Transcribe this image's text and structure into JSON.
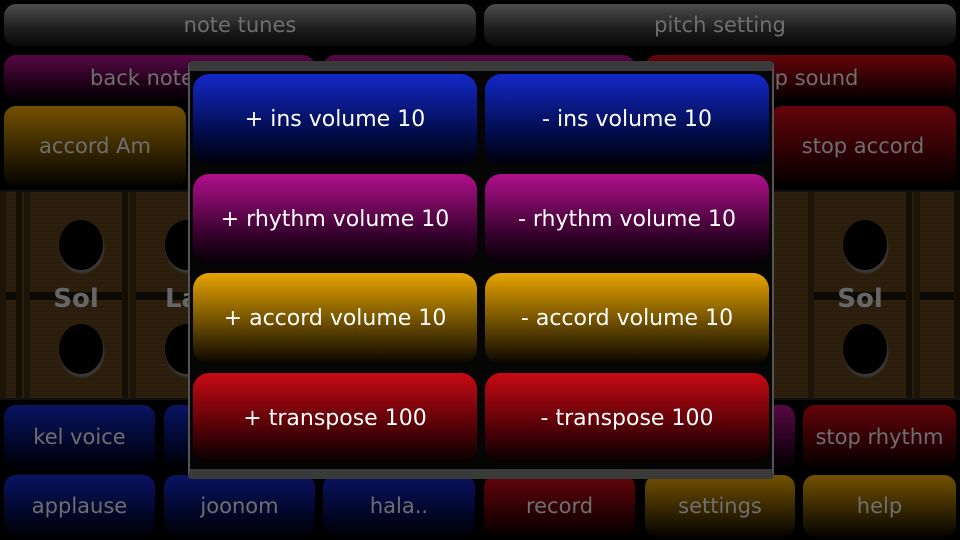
{
  "top_buttons": [
    "note tunes",
    "pitch setting"
  ],
  "row2": {
    "back_note": "back note",
    "stop_sound": "stop sound"
  },
  "row3": {
    "accord": "accord Am",
    "stop_accord": "stop accord"
  },
  "notes": [
    "Sol",
    "La",
    "Sol"
  ],
  "row4": {
    "voice": "kel voice",
    "stop_rhythm": "stop rhythm"
  },
  "row5": [
    "applause",
    "joonom",
    "hala..",
    "record",
    "settings",
    "help"
  ],
  "dialog": {
    "buttons": [
      {
        "label": "+ ins volume 10",
        "color": "#1428c8"
      },
      {
        "label": "- ins volume 10",
        "color": "#1428c8"
      },
      {
        "label": "+ rhythm volume 10",
        "color": "#b0108c"
      },
      {
        "label": "- rhythm volume 10",
        "color": "#b0108c"
      },
      {
        "label": "+ accord volume  10",
        "color": "#e8a400"
      },
      {
        "label": "- accord volume 10",
        "color": "#e8a400"
      },
      {
        "label": "+ transpose 100",
        "color": "#c80a14"
      },
      {
        "label": "- transpose 100",
        "color": "#c80a14"
      }
    ]
  }
}
